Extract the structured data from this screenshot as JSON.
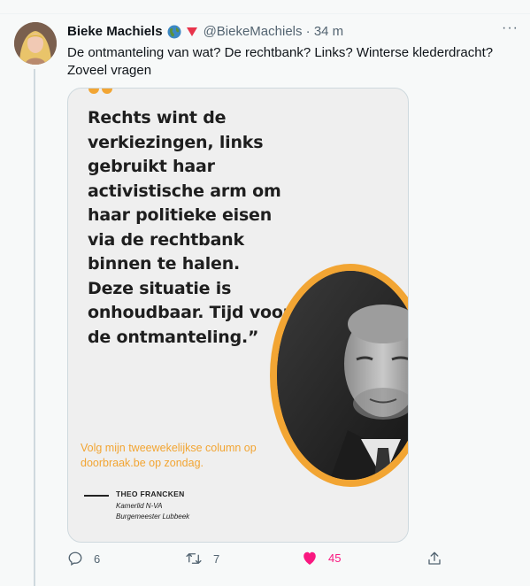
{
  "tweet": {
    "author_name": "Bieke Machiels",
    "badges": [
      "globe-emoji-icon",
      "red-triangle-down-icon"
    ],
    "handle_and_time": "@BiekeMachiels · 34 m",
    "more_label": "···",
    "text": "De ontmanteling van wat? De rechtbank? Links? Winterse klederdracht? Zoveel vragen"
  },
  "media_card": {
    "quote": "Rechts wint de verkiezingen, links gebruikt haar activistische arm om haar politieke eisen via de rechtbank binnen te halen. Deze situatie is onhoudbaar. Tijd voor de ontmanteling.”",
    "promo": "Volg mijn tweewekelijkse column op doorbraak.be op zondag.",
    "signature_name": "THEO FRANCKEN",
    "signature_role_1": "Kamerlid N-VA",
    "signature_role_2": "Burgemeester Lubbeek",
    "accent_color": "#f2a533"
  },
  "actions": {
    "reply_count": "6",
    "retweet_count": "7",
    "like_count": "45",
    "like_color": "#f91880"
  }
}
